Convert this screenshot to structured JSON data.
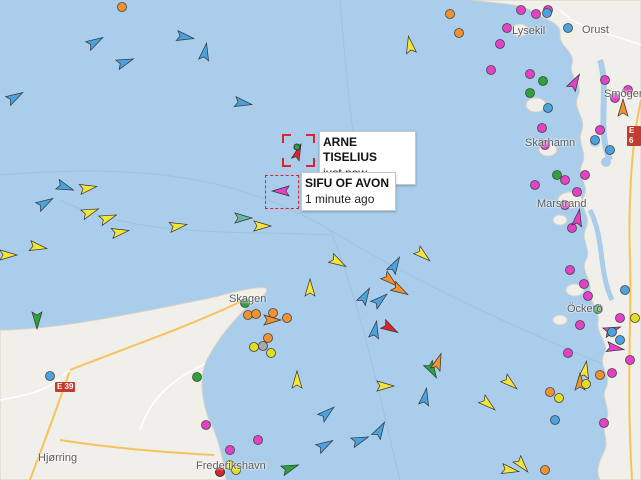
{
  "places": [
    {
      "id": "lysekil-area",
      "label": "Orust"
    },
    {
      "id": "skagen",
      "label": "Skagen"
    },
    {
      "id": "hjorring",
      "label": "Hjørring"
    },
    {
      "id": "frederikshavn",
      "label": "Frederikshavn"
    },
    {
      "id": "skarhamn",
      "label": "Skärhamn"
    },
    {
      "id": "marstrand",
      "label": "Marstrand"
    },
    {
      "id": "ockero",
      "label": "Öckerö"
    },
    {
      "id": "smogen",
      "label": "Smögen"
    },
    {
      "id": "bohus",
      "label": "Lysekil"
    }
  ],
  "roads": [
    {
      "id": "e39-north",
      "label": "E 39"
    },
    {
      "id": "e6",
      "label": "E 6"
    }
  ],
  "vessels_selected": [
    {
      "name": "ARNE TISELIUS",
      "time": "just now",
      "color": "#d9262e"
    },
    {
      "name": "SIFU OF AVON",
      "time": "1 minute ago",
      "color": "#e540c8"
    }
  ],
  "vessel_colors": {
    "cargo": "#4aa3df",
    "tanker": "#f5e43a",
    "passenger": "#2aa43a",
    "fishing": "#f0922e",
    "pleasure": "#e540c8",
    "unknown": "#a8a8a8",
    "highspeed": "#e0e020",
    "tug": "#6ab7a0"
  }
}
